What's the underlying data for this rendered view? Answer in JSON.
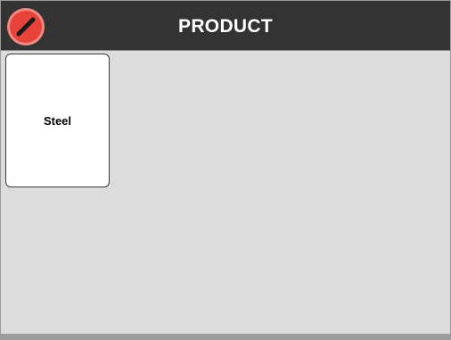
{
  "header": {
    "title": "PRODUCT",
    "cancel_icon": "cancel-circle-icon"
  },
  "products": [
    {
      "label": "Steel"
    }
  ],
  "colors": {
    "header_bg": "#333333",
    "content_bg": "#dcdcdc",
    "tile_bg": "#ffffff",
    "cancel_red": "#e8433a"
  }
}
